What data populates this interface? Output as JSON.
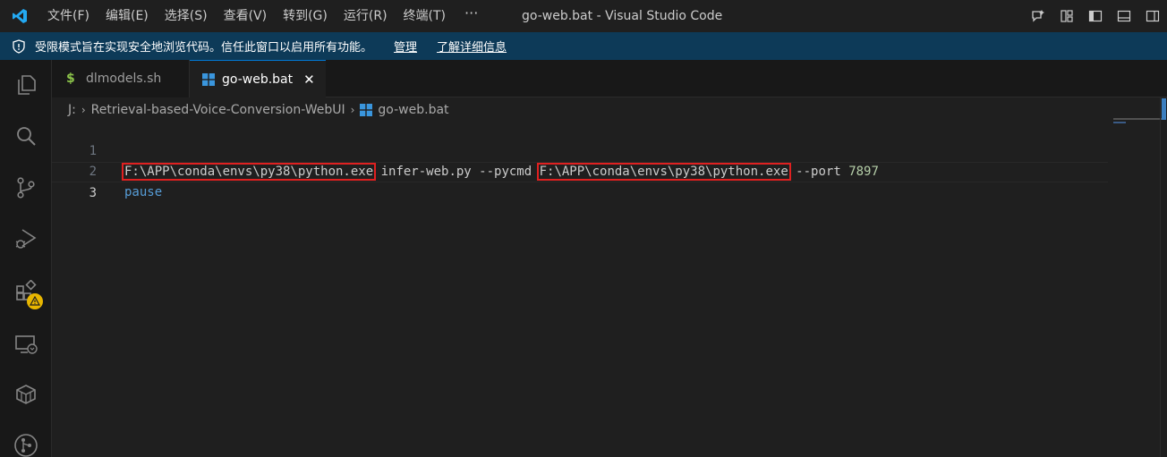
{
  "titlebar": {
    "menus": [
      "文件(F)",
      "编辑(E)",
      "选择(S)",
      "查看(V)",
      "转到(G)",
      "运行(R)",
      "终端(T)"
    ],
    "more": "···",
    "window_title": "go-web.bat - Visual Studio Code",
    "actions": [
      "copilot-icon",
      "customize-layout-icon",
      "toggle-sidebar-icon",
      "toggle-panel-icon",
      "toggle-secondary-sidebar-icon"
    ]
  },
  "banner": {
    "text": "受限模式旨在实现安全地浏览代码。信任此窗口以启用所有功能。",
    "manage_label": "管理",
    "learn_more_label": "了解详细信息"
  },
  "activitybar": [
    "explorer-icon",
    "search-icon",
    "source-control-icon",
    "run-debug-icon",
    "extensions-icon",
    "remote-explorer-icon",
    "containers-icon",
    "git-graph-icon"
  ],
  "tabs": [
    {
      "label": "dlmodels.sh",
      "icon": "$",
      "active": false
    },
    {
      "label": "go-web.bat",
      "icon": "windows-icon",
      "active": true,
      "close": "✕"
    }
  ],
  "breadcrumb": {
    "drive": "J:",
    "folder": "Retrieval-based-Voice-Conversion-WebUI",
    "file": "go-web.bat",
    "separator": "›"
  },
  "editor": {
    "line_numbers": [
      "1",
      "2",
      "3"
    ],
    "line1": {
      "exe1": "F:\\APP\\conda\\envs\\py38\\python.exe",
      "mid": " infer-web.py --pycmd ",
      "exe2": "F:\\APP\\conda\\envs\\py38\\python.exe",
      "port_flag": " --port ",
      "port": "7897"
    },
    "line2": "pause",
    "line3": ""
  },
  "colors": {
    "accent": "#0078d4",
    "banner_bg": "#0d3a58",
    "highlight_box": "#e02020",
    "keyword": "#569cd6",
    "number": "#b5cea8"
  }
}
